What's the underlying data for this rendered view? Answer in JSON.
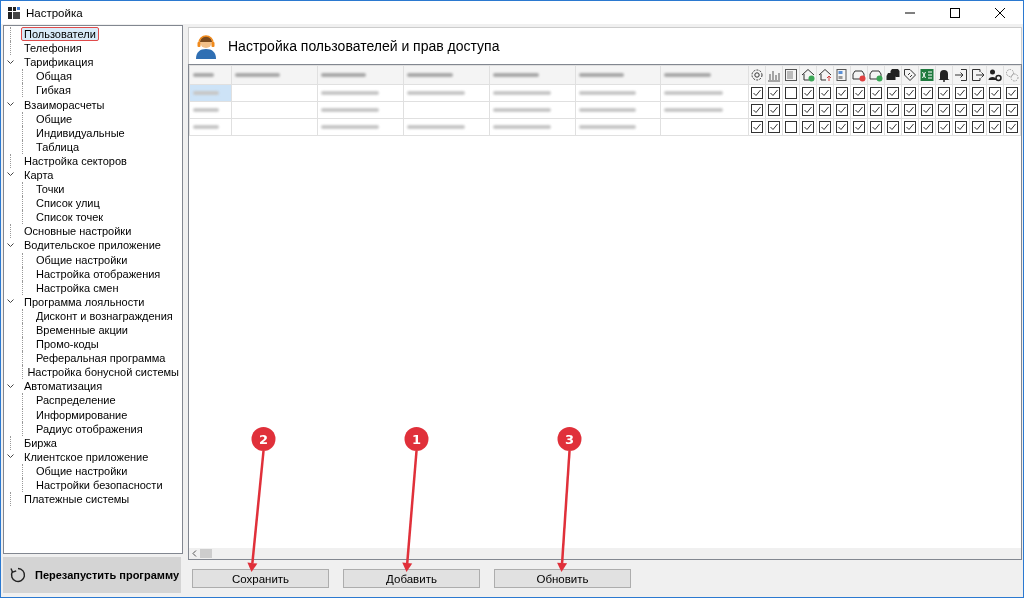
{
  "window": {
    "title": "Настройка"
  },
  "sidebar": {
    "tree": [
      {
        "label": "Пользователи",
        "selected": true
      },
      {
        "label": "Телефония",
        "selected": false
      },
      {
        "label": "Тарификация",
        "selected": false,
        "expanded": true,
        "children": [
          {
            "label": "Общая",
            "selected": false
          },
          {
            "label": "Гибкая",
            "selected": false
          }
        ]
      },
      {
        "label": "Взаиморасчеты",
        "selected": false,
        "expanded": true,
        "children": [
          {
            "label": "Общие",
            "selected": false
          },
          {
            "label": "Индивидуальные",
            "selected": false
          },
          {
            "label": "Таблица",
            "selected": false
          }
        ]
      },
      {
        "label": "Настройка секторов",
        "selected": false
      },
      {
        "label": "Карта",
        "selected": false,
        "expanded": true,
        "children": [
          {
            "label": "Точки",
            "selected": false
          },
          {
            "label": "Список улиц",
            "selected": false
          },
          {
            "label": "Список точек",
            "selected": false
          }
        ]
      },
      {
        "label": "Основные настройки",
        "selected": false
      },
      {
        "label": "Водительское приложение",
        "selected": false,
        "expanded": true,
        "children": [
          {
            "label": "Общие настройки",
            "selected": false
          },
          {
            "label": "Настройка отображения",
            "selected": false
          },
          {
            "label": "Настройка смен",
            "selected": false
          }
        ]
      },
      {
        "label": "Программа лояльности",
        "selected": false,
        "expanded": true,
        "children": [
          {
            "label": "Дисконт и вознаграждения",
            "selected": false
          },
          {
            "label": "Временные акции",
            "selected": false
          },
          {
            "label": "Промо-коды",
            "selected": false
          },
          {
            "label": "Реферальная программа",
            "selected": false
          },
          {
            "label": "Настройка бонусной системы",
            "selected": false
          }
        ]
      },
      {
        "label": "Автоматизация",
        "selected": false,
        "expanded": true,
        "children": [
          {
            "label": "Распределение",
            "selected": false
          },
          {
            "label": "Информирование",
            "selected": false
          },
          {
            "label": "Радиус отображения",
            "selected": false
          }
        ]
      },
      {
        "label": "Биржа",
        "selected": false
      },
      {
        "label": "Клиентское приложение",
        "selected": false,
        "expanded": true,
        "children": [
          {
            "label": "Общие настройки",
            "selected": false
          },
          {
            "label": "Настройки безопасности",
            "selected": false
          }
        ]
      },
      {
        "label": "Платежные системы",
        "selected": false
      }
    ],
    "restart_button": "Перезапустить программу"
  },
  "main": {
    "title": "Настройка пользователей и прав доступа",
    "table": {
      "columns": [
        {
          "blurred": true
        },
        {
          "blurred": true
        },
        {
          "blurred": true
        },
        {
          "blurred": true
        },
        {
          "blurred": true
        },
        {
          "blurred": true
        },
        {
          "blurred": true
        }
      ],
      "rows": [
        {
          "selected": true,
          "cells": [
            {
              "blurred": true
            },
            {
              "blurred": false
            },
            {
              "blurred": true
            },
            {
              "blurred": true
            },
            {
              "blurred": true
            },
            {
              "blurred": true
            },
            {
              "blurred": true
            }
          ],
          "checks": [
            true,
            true,
            false,
            true,
            true,
            true,
            true,
            true,
            true,
            true,
            true,
            true,
            true,
            true,
            true,
            true
          ]
        },
        {
          "selected": false,
          "cells": [
            {
              "blurred": true
            },
            {
              "blurred": false
            },
            {
              "blurred": true
            },
            {
              "blurred": false
            },
            {
              "blurred": true
            },
            {
              "blurred": true
            },
            {
              "blurred": true
            }
          ],
          "checks": [
            true,
            true,
            false,
            true,
            true,
            true,
            true,
            true,
            true,
            true,
            true,
            true,
            true,
            true,
            true,
            true
          ]
        },
        {
          "selected": false,
          "cells": [
            {
              "blurred": true
            },
            {
              "blurred": false
            },
            {
              "blurred": true
            },
            {
              "blurred": true
            },
            {
              "blurred": true
            },
            {
              "blurred": true
            },
            {
              "blurred": false
            }
          ],
          "checks": [
            true,
            true,
            false,
            true,
            true,
            true,
            true,
            true,
            true,
            true,
            true,
            true,
            true,
            true,
            true,
            true
          ]
        }
      ]
    },
    "buttons": [
      "Сохранить",
      "Добавить",
      "Обновить"
    ]
  },
  "callouts": [
    {
      "number": "2"
    },
    {
      "number": "1"
    },
    {
      "number": "3"
    }
  ]
}
